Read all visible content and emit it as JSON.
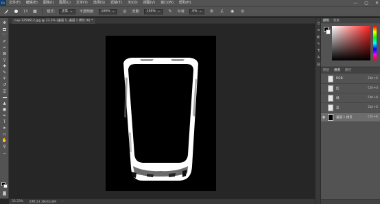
{
  "menubar": {
    "logo": "Ps",
    "items": [
      "文件(F)",
      "编辑(E)",
      "图像(I)",
      "图层(L)",
      "文字(Y)",
      "选择(S)",
      "滤镜(T)",
      "3D(D)",
      "视图(V)",
      "窗口(W)",
      "帮助(H)"
    ],
    "window_controls": [
      "—",
      "▢",
      "✕"
    ]
  },
  "options": {
    "brush_size": "13",
    "mode_label": "模式:",
    "mode_value": "正常",
    "opacity_label": "不透明度:",
    "opacity_value": "100%",
    "flow_label": "流量:",
    "flow_value": "100%",
    "smoothing_label": "平滑:",
    "smoothing_value": "0%"
  },
  "document": {
    "tab_title": "cup-1250612.jpg @ 33.3% (通道 1, 通道 1 拷贝 /8) *",
    "zoom": "33.33%",
    "doc_info": "文档:23.3M/43.8M"
  },
  "color_panel": {
    "tabs": [
      "颜色",
      "色板"
    ]
  },
  "layers_panel": {
    "tabs": [
      "图层",
      "通道",
      "路径"
    ],
    "channels": [
      {
        "name": "RGB",
        "shortcut": "Ctrl+2",
        "selected": false,
        "visible": false
      },
      {
        "name": "红",
        "shortcut": "Ctrl+3",
        "selected": false,
        "visible": false
      },
      {
        "name": "绿",
        "shortcut": "Ctrl+4",
        "selected": false,
        "visible": false
      },
      {
        "name": "蓝",
        "shortcut": "Ctrl+5",
        "selected": false,
        "visible": false
      },
      {
        "name": "通道 1 拷贝",
        "shortcut": "Ctrl+6",
        "selected": true,
        "visible": true
      }
    ]
  },
  "colors": {
    "ui_dark": "#535353",
    "canvas_bg": "#262626",
    "document_bg": "#000000",
    "glass_outline": "#ffffff",
    "accent_blue": "#31a8ff"
  }
}
